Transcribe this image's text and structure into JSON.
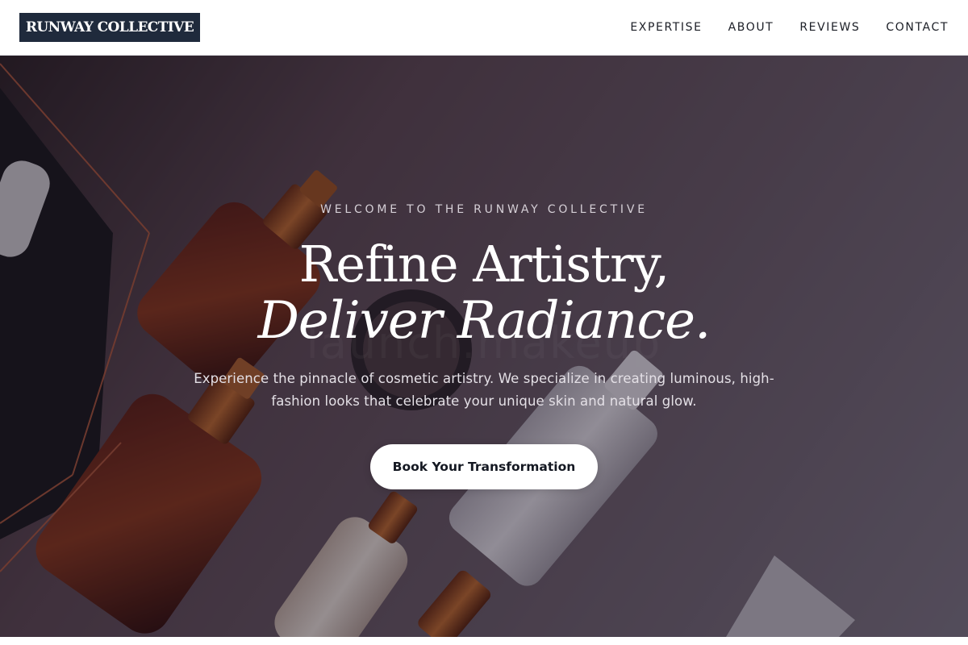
{
  "header": {
    "logo_text": "RUNWAY COLLECTIVE",
    "nav": [
      {
        "label": "EXPERTISE"
      },
      {
        "label": "ABOUT"
      },
      {
        "label": "REVIEWS"
      },
      {
        "label": "CONTACT"
      }
    ]
  },
  "hero": {
    "eyebrow": "WELCOME TO THE RUNWAY COLLECTIVE",
    "headline_line1": "Refine Artistry,",
    "headline_line2": "Deliver Radiance.",
    "subtext": "Experience the pinnacle of cosmetic artistry. We specialize in creating luminous, high-fashion looks that celebrate your unique skin and natural glow.",
    "cta_label": "Book Your Transformation",
    "background_image_text": "launch.makeup"
  },
  "colors": {
    "logo_bg": "#1f2a3c",
    "cta_bg": "#ffffff",
    "hero_overlay": "#181422"
  }
}
